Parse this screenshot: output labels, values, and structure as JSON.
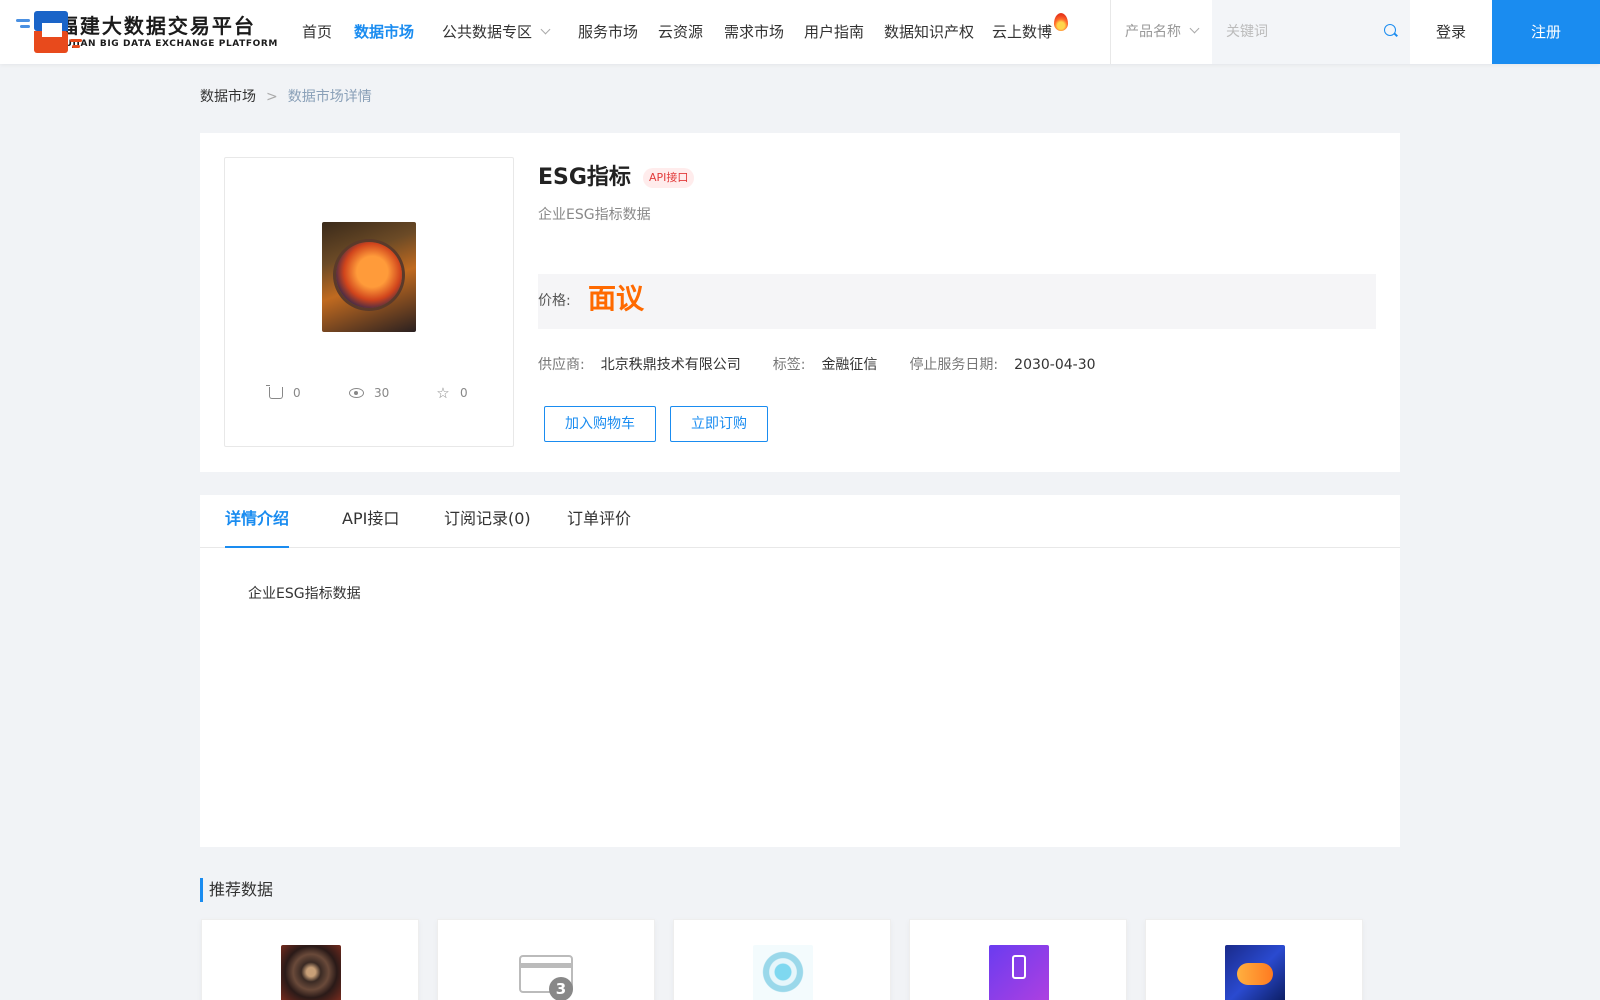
{
  "header": {
    "logo_cn": "福建大数据交易平台",
    "logo_en": "FUJIAN BIG DATA EXCHANGE  PLATFORM",
    "nav": [
      {
        "label": "首页"
      },
      {
        "label": "数据市场",
        "active": true
      },
      {
        "label": "公共数据专区",
        "dropdown": true
      },
      {
        "label": "服务市场"
      },
      {
        "label": "云资源"
      },
      {
        "label": "需求市场"
      },
      {
        "label": "用户指南"
      },
      {
        "label": "数据知识产权"
      },
      {
        "label": "云上数博",
        "icon": "fire-icon"
      }
    ],
    "search_type": "产品名称",
    "search_placeholder": "关键词",
    "login": "登录",
    "register": "注册",
    "accent": "#1a8cf0"
  },
  "breadcrumb": {
    "parent": "数据市场",
    "separator": ">",
    "current": "数据市场详情"
  },
  "product": {
    "title": "ESG指标",
    "badge": "API接口",
    "description": "企业ESG指标数据",
    "price_label": "价格:",
    "price_value": "面议",
    "stats": {
      "cart": "0",
      "views": "30",
      "favorites": "0"
    },
    "supplier_label": "供应商:",
    "supplier": "北京秩鼎技术有限公司",
    "tag_label": "标签:",
    "tag": "金融征信",
    "end_date_label": "停止服务日期:",
    "end_date": "2030-04-30",
    "add_cart": "加入购物车",
    "subscribe": "立即订购"
  },
  "tabs": [
    {
      "label": "详情介绍",
      "active": true
    },
    {
      "label": "API接口"
    },
    {
      "label": "订阅记录(0)"
    },
    {
      "label": "订单评价"
    }
  ],
  "detail_text": "企业ESG指标数据",
  "recommended": {
    "title": "推荐数据"
  }
}
